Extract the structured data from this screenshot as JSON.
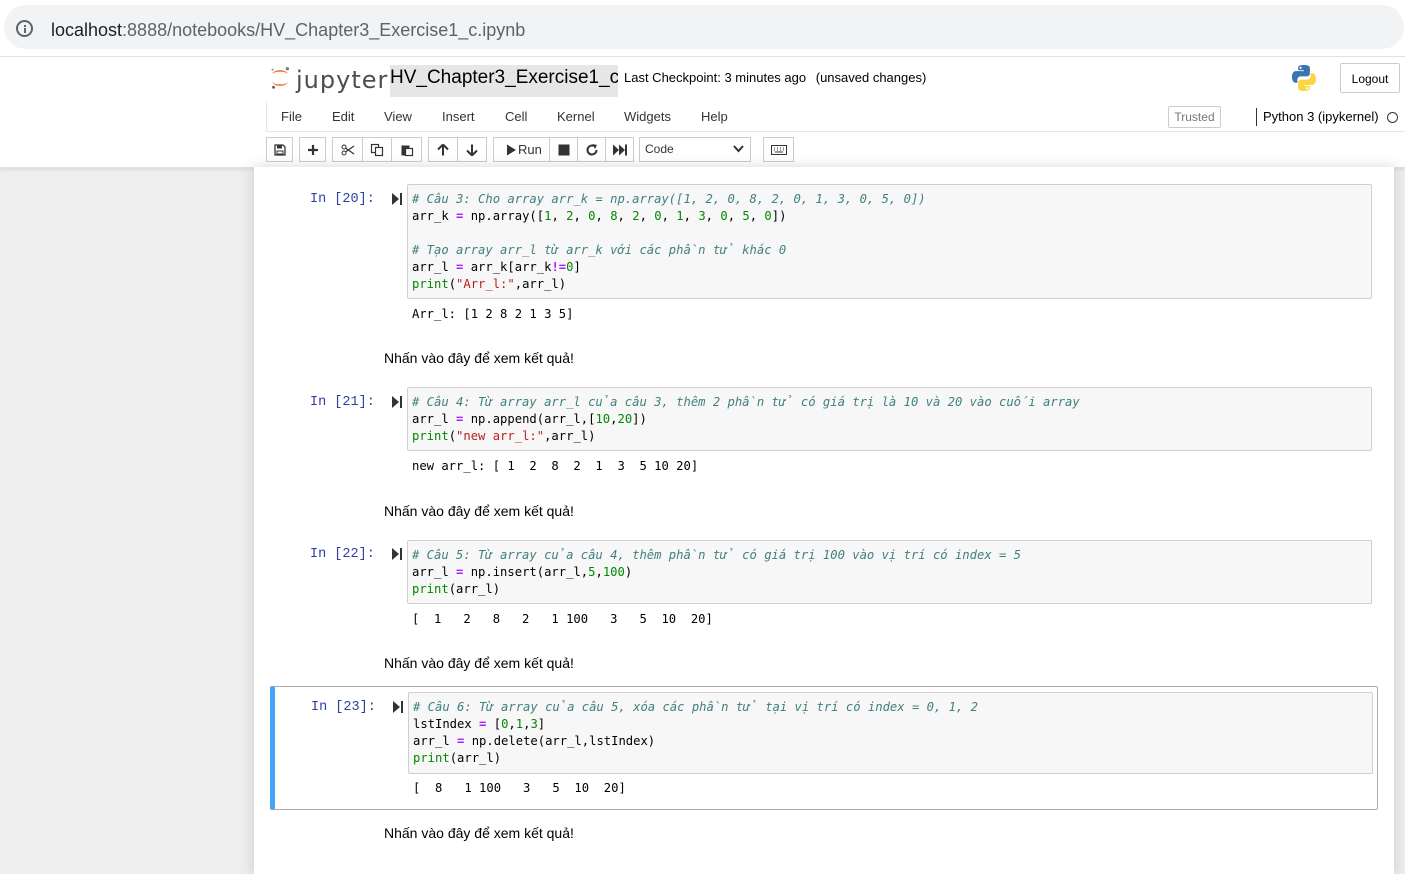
{
  "browser": {
    "url_host": "localhost",
    "url_rest": ":8888/notebooks/HV_Chapter3_Exercise1_c.ipynb"
  },
  "header": {
    "logo_text": "jupyter",
    "notebook_title": "HV_Chapter3_Exercise1_c",
    "checkpoint": "Last Checkpoint: 3 minutes ago",
    "unsaved": "(unsaved changes)",
    "logout_label": "Logout"
  },
  "menu": {
    "items": [
      "File",
      "Edit",
      "View",
      "Insert",
      "Cell",
      "Kernel",
      "Widgets",
      "Help"
    ],
    "trusted_label": "Trusted",
    "kernel_name": "Python 3 (ipykernel)"
  },
  "toolbar": {
    "run_label": "Run",
    "cell_type": "Code",
    "icons": [
      "save-icon",
      "plus-icon",
      "cut-icon",
      "copy-icon",
      "paste-icon",
      "arrow-up-icon",
      "arrow-down-icon",
      "play-icon",
      "stop-icon",
      "restart-icon",
      "fast-forward-icon",
      "chevron-down-icon",
      "keyboard-icon"
    ]
  },
  "cells": [
    {
      "prompt": "In [20]:",
      "lines": [
        "# Câu 3: Cho array arr_k = np.array([1, 2, 0, 8, 2, 0, 1, 3, 0, 5, 0])",
        "arr_k = np.array([1, 2, 0, 8, 2, 0, 1, 3, 0, 5, 0])",
        "",
        "# Tạo array arr_l từ arr_k với các phần tử khác 0",
        "arr_l = arr_k[arr_k!=0]",
        "print(\"Arr_l:\",arr_l)"
      ],
      "output": "Arr_l: [1 2 8 2 1 3 5]",
      "markdown": "Nhấn vào đây để xem kết quả!"
    },
    {
      "prompt": "In [21]:",
      "lines": [
        "# Câu 4: Từ array arr_l của câu 3, thêm 2 phần tử có giá trị là 10 và 20 vào cuối array",
        "arr_l = np.append(arr_l,[10,20])",
        "print(\"new arr_l:\",arr_l)"
      ],
      "output": "new arr_l: [ 1  2  8  2  1  3  5 10 20]",
      "markdown": "Nhấn vào đây để xem kết quả!"
    },
    {
      "prompt": "In [22]:",
      "lines": [
        "# Câu 5: Từ array của câu 4, thêm phần tử có giá trị 100 vào vị trí có index = 5",
        "arr_l = np.insert(arr_l,5,100)",
        "print(arr_l)"
      ],
      "output": "[  1   2   8   2   1 100   3   5  10  20]",
      "markdown": "Nhấn vào đây để xem kết quả!"
    },
    {
      "prompt": "In [23]:",
      "lines": [
        "# Câu 6: Từ array của câu 5, xóa các phần tử tại vị trí có index = 0, 1, 2",
        "lstIndex = [0,1,3]",
        "arr_l = np.delete(arr_l,lstIndex)",
        "print(arr_l)"
      ],
      "output": "[  8   1 100   3   5  10  20]",
      "markdown": "Nhấn vào đây để xem kết quả!"
    }
  ]
}
